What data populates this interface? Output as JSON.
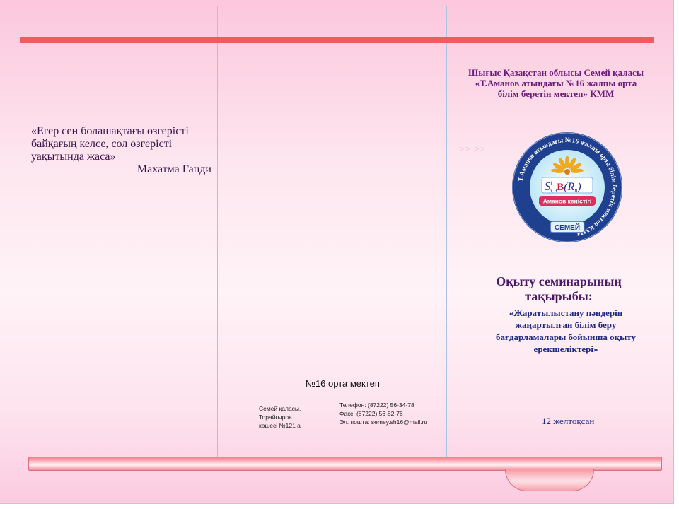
{
  "quote": {
    "text_lines": [
      "«Егер сен болашақтағы өзгерісті",
      "байқағың келсе, сол өзгерісті",
      "уақытында жаса»"
    ],
    "author": "Махатма Ганди"
  },
  "back_panel": {
    "school_name": "№16 орта мектеп",
    "address_lines": [
      "Семей қаласы, Торайғыров",
      "көшесі №121 а"
    ],
    "phone": "Телефон: (87222) 56-34-78",
    "fax": "Факс: (87222) 56-82-76",
    "email": "Эл. пошта: semey.sh16@mail.ru"
  },
  "front_panel": {
    "header_lines": [
      "Шығыс Қазақстан облысы Семей қаласы",
      "«Т.Аманов атындағы  №16 жалпы орта",
      "білім беретін мектеп» КММ"
    ],
    "decorative_arrows": ">> >>",
    "logo": {
      "ring_text": "Т.Аманов атындағы №16 жалпы орта білім беретін мектеп КММ",
      "formula_main": "S",
      "formula_sup": "t",
      "formula_sub": "p, θ",
      "formula_b": "B",
      "formula_r": "(R",
      "formula_rsub": "n",
      "formula_close": ")",
      "ribbon_text": "Аманов кеністігі",
      "city_label": "СЕМЕЙ"
    },
    "seminar_title_lines": [
      "Оқыту семинарының",
      "тақырыбы:"
    ],
    "seminar_topic_lines": [
      "«Жаратылыстану пәндерін",
      "жаңартылған білім беру",
      "бағдарламалары бойынша оқыту",
      "ерекшеліктері»"
    ],
    "date": "12 желтоқсан"
  },
  "colors": {
    "top_bar": "#ef5b5e",
    "heading_purple": "#6b1b7a",
    "topic_blue": "#1e2a82",
    "logo_ring": "#1f3f8f"
  }
}
